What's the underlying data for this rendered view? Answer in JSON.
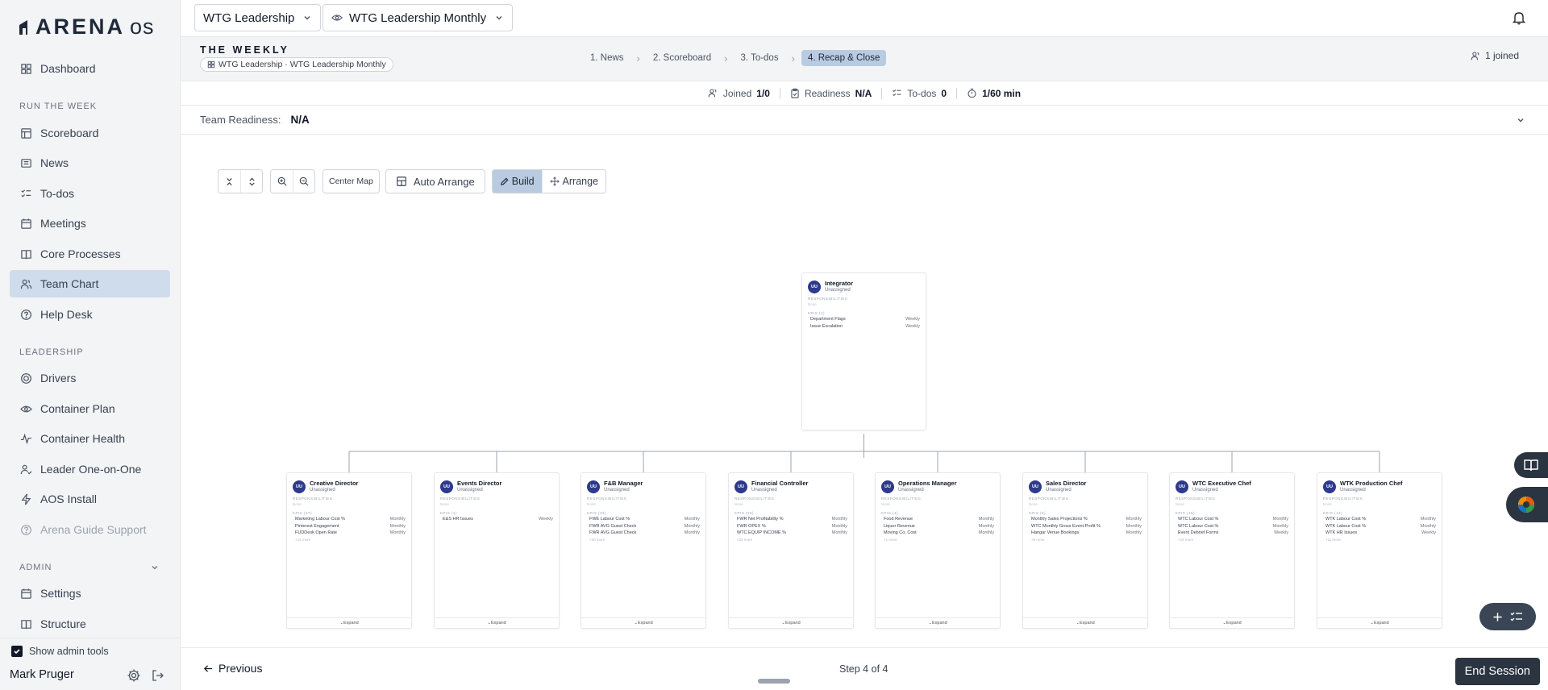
{
  "app": {
    "logo_text": "ARENA",
    "logo_suffix": "os"
  },
  "sidebar": {
    "dashboard": "Dashboard",
    "section_run": "RUN THE WEEK",
    "run_items": [
      "Scoreboard",
      "News",
      "To-dos",
      "Meetings",
      "Core Processes",
      "Team Chart",
      "Help Desk"
    ],
    "section_leadership": "LEADERSHIP",
    "leadership_items": [
      "Drivers",
      "Container Plan",
      "Container Health",
      "Leader One-on-One",
      "AOS Install",
      "Arena Guide Support"
    ],
    "section_admin": "ADMIN",
    "admin_items": [
      "Settings",
      "Structure"
    ],
    "admin_tools_label": "Show admin tools",
    "user_name": "Mark Pruger"
  },
  "topbar": {
    "team_select": "WTG Leadership",
    "meeting_select": "WTG Leadership Monthly"
  },
  "weekly": {
    "title": "THE WEEKLY",
    "chip": "WTG Leadership · WTG Leadership Monthly",
    "steps": [
      "1. News",
      "2. Scoreboard",
      "3. To-dos",
      "4. Recap & Close"
    ],
    "joined": "1 joined"
  },
  "stats": {
    "joined_label": "Joined",
    "joined_value": "1/0",
    "readiness_label": "Readiness",
    "readiness_value": "N/A",
    "todos_label": "To-dos",
    "todos_value": "0",
    "timer": "1/60 min"
  },
  "team_readiness": {
    "label": "Team Readiness:",
    "value": "N/A"
  },
  "toolbar": {
    "center_map": "Center Map",
    "auto_arrange": "Auto Arrange",
    "build": "Build",
    "arrange": "Arrange"
  },
  "org": {
    "avatar_initials": "UU",
    "status": "Unassigned",
    "responsibilities_label": "RESPONSIBILITIES",
    "none_label": "None",
    "expand_label": "Expand",
    "root": {
      "title": "Integrator",
      "kpi_label": "KPIS (2)",
      "kpis": [
        [
          "Department Flags",
          "Weekly"
        ],
        [
          "Issue Escalation",
          "Weekly"
        ]
      ]
    },
    "children": [
      {
        "title": "Creative Director",
        "kpi_label": "KPIS (17)",
        "kpis": [
          [
            "Marketing Labour Cost %",
            "Monthly"
          ],
          [
            "Pinterest Engagement",
            "Monthly"
          ],
          [
            "FUDDesk Open Rate",
            "Monthly"
          ]
        ],
        "more": "+14 more"
      },
      {
        "title": "Events Director",
        "kpi_label": "KPIS (1)",
        "kpis": [
          [
            "E&S HR Issues",
            "Weekly"
          ]
        ],
        "more": ""
      },
      {
        "title": "F&B Manager",
        "kpi_label": "KPIS (33)",
        "kpis": [
          [
            "FWE Labour Cost %",
            "Monthly"
          ],
          [
            "FWR AVG Guest Check",
            "Monthly"
          ],
          [
            "FWR AVG Guest Check",
            "Monthly"
          ]
        ],
        "more": "+30 more"
      },
      {
        "title": "Financial Controller",
        "kpi_label": "KPIS (25)",
        "kpis": [
          [
            "FWR Net Profitability %",
            "Monthly"
          ],
          [
            "FWR OPEX %",
            "Monthly"
          ],
          [
            "WTC EQUIP INCOME %",
            "Monthly"
          ]
        ],
        "more": "+22 more"
      },
      {
        "title": "Operations Manager",
        "kpi_label": "KPIS (4)",
        "kpis": [
          [
            "Food Revenue",
            "Monthly"
          ],
          [
            "Liquor Revenue",
            "Monthly"
          ],
          [
            "Moving Co. Cost",
            "Monthly"
          ]
        ],
        "more": "+1 more"
      },
      {
        "title": "Sales Director",
        "kpi_label": "KPIS (9)",
        "kpis": [
          [
            "Monthly Sales Projections %",
            "Monthly"
          ],
          [
            "WTC Monthly Gross Event Profit %",
            "Monthly"
          ],
          [
            "Hangar Venue Bookings",
            "Monthly"
          ]
        ],
        "more": "+6 more"
      },
      {
        "title": "WTC Executive Chef",
        "kpi_label": "KPIS (19)",
        "kpis": [
          [
            "WTC Labour Cost %",
            "Monthly"
          ],
          [
            "WTC Labour Cost %",
            "Monthly"
          ],
          [
            "Event Debrief Forms",
            "Weekly"
          ]
        ],
        "more": "+16 more"
      },
      {
        "title": "WTK Production Chef",
        "kpi_label": "KPIS (14)",
        "kpis": [
          [
            "WTK Labour Cost %",
            "Monthly"
          ],
          [
            "WTK Labour Cost %",
            "Monthly"
          ],
          [
            "WTK HR Issues",
            "Weekly"
          ]
        ],
        "more": "+11 more"
      }
    ]
  },
  "bottom": {
    "previous": "Previous",
    "step": "Step 4 of 4",
    "end_session": "End Session"
  }
}
